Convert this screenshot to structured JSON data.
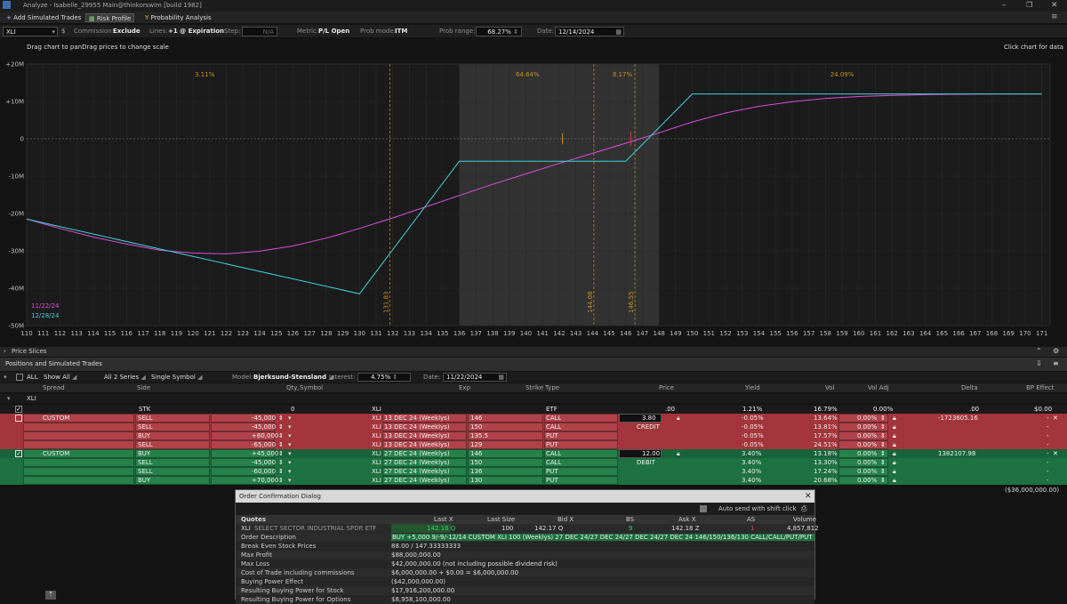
{
  "window": {
    "title": "Analyze - Isabelle_29955 Main@thinkorswim [build 1982]"
  },
  "toolbar": {
    "add_trades": "Add Simulated Trades",
    "risk_profile": "Risk Profile",
    "probability": "Probability Analysis"
  },
  "settings": {
    "symbol": "XLI",
    "commission_label": "Commission:",
    "commission_value": "Exclude",
    "lines_label": "Lines:",
    "lines_value": "+1 @ Expiration",
    "step_label": "Step:",
    "step_value": "N/A",
    "metric_label": "Metric:",
    "metric_value": "P/L Open",
    "prob_mode_label": "Prob mode:",
    "prob_mode_value": "ITM",
    "prob_range_label": "Prob range:",
    "prob_range_value": "68.27%",
    "date_label": "Date:",
    "date_value": "12/14/2024"
  },
  "chart_hint": {
    "left": "Drag chart to panDrag prices to change scale",
    "right": "Click chart for data"
  },
  "chart_data": {
    "type": "line",
    "x_range": [
      110,
      171.5
    ],
    "y_range": [
      -50,
      20
    ],
    "x_ticks": [
      110,
      111,
      112,
      113,
      114,
      115,
      116,
      117,
      118,
      119,
      120,
      121,
      122,
      123,
      124,
      125,
      126,
      127,
      128,
      129,
      130,
      131,
      132,
      133,
      134,
      135,
      136,
      137,
      138,
      139,
      140,
      141,
      142,
      143,
      144,
      145,
      146,
      147,
      148,
      149,
      150,
      151,
      152,
      153,
      154,
      155,
      156,
      157,
      158,
      159,
      160,
      161,
      162,
      163,
      164,
      165,
      166,
      167,
      168,
      169,
      170,
      171
    ],
    "y_ticks": [
      {
        "v": 20,
        "label": "+20M"
      },
      {
        "v": 10,
        "label": "+10M"
      },
      {
        "v": 0,
        "label": "0"
      },
      {
        "v": -10,
        "label": "-10M"
      },
      {
        "v": -20,
        "label": "-20M"
      },
      {
        "v": -30,
        "label": "-30M"
      },
      {
        "v": -40,
        "label": "-40M"
      },
      {
        "v": -50,
        "label": "-50M"
      }
    ],
    "shaded_range": [
      136,
      148
    ],
    "prob_labels": [
      {
        "x": 120.7,
        "label": "3.11%"
      },
      {
        "x": 140.1,
        "label": "64.64%"
      },
      {
        "x": 145.8,
        "label": "8.17%"
      },
      {
        "x": 159.0,
        "label": "24.09%"
      }
    ],
    "vlines": [
      {
        "x": 131.83,
        "label": "131.83"
      },
      {
        "x": 144.08,
        "label": "144.08"
      },
      {
        "x": 146.55,
        "label": "146.55"
      }
    ],
    "series": [
      {
        "name": "11/22/24",
        "color": "#d94fd9",
        "x": [
          110,
          112,
          114,
          116,
          118,
          120,
          122,
          124,
          126,
          128,
          130,
          132,
          134,
          136,
          138,
          140,
          142,
          144,
          146,
          148,
          150,
          152,
          154,
          156,
          158,
          160,
          162,
          164,
          166,
          168,
          171
        ],
        "y": [
          -21.5,
          -24,
          -26.3,
          -28.2,
          -29.8,
          -30.6,
          -30.8,
          -30.1,
          -28.7,
          -26.6,
          -24,
          -21.2,
          -18.2,
          -15.2,
          -12.2,
          -9.4,
          -6.6,
          -3.9,
          -1.2,
          1.6,
          4.5,
          6.9,
          8.7,
          9.9,
          10.8,
          11.3,
          11.6,
          11.8,
          11.9,
          12,
          12
        ]
      },
      {
        "name": "12/28/24",
        "color": "#3fd1d9",
        "x": [
          110,
          130,
          136,
          146,
          150,
          171
        ],
        "y": [
          -21.5,
          -41.5,
          -6,
          -6,
          12,
          12
        ]
      }
    ]
  },
  "panels": {
    "price_slices": "Price Slices",
    "positions": "Positions and Simulated Trades"
  },
  "filters": {
    "all": "ALL",
    "show_all": "Show All",
    "series": "All 2 Series",
    "symbol_mode": "Single Symbol",
    "model_label": "Model:",
    "model_value": "Bjerksund-Stensland",
    "interest_label": "Interest:",
    "interest_value": "4.75%",
    "date_label": "Date:",
    "date_value": "11/22/2024"
  },
  "columns": [
    "Spread",
    "Side",
    "Qty",
    "Symbol",
    "Exp",
    "Strike",
    "Type",
    "Price",
    "Yield",
    "Vol",
    "Vol Adj",
    "Delta",
    "BP Effect"
  ],
  "group": {
    "label": "XLI"
  },
  "stk": {
    "side": "STK",
    "qty": "0",
    "symbol": "XLI",
    "type": "ETF",
    "price": ".00",
    "yield": "1.21%",
    "vol": "16.79%",
    "voladj": "0.00%",
    "delta": ".00",
    "bp": "$0.00"
  },
  "legs": [
    {
      "spread": "CUSTOM",
      "side": "SELL",
      "qty": "-45,000",
      "symbol": "XLI",
      "exp": "13 DEC 24 (Weeklys)",
      "strike": "146",
      "type": "CALL",
      "price": "3.80",
      "yield": "-0.05%",
      "vol": "13.64%",
      "voladj": "0.00%",
      "delta": "-1723605.16",
      "bp": "-",
      "color": "red"
    },
    {
      "spread": "",
      "side": "SELL",
      "qty": "-45,000",
      "symbol": "XLI",
      "exp": "13 DEC 24 (Weeklys)",
      "strike": "150",
      "type": "CALL",
      "price": "CREDIT",
      "yield": "-0.05%",
      "vol": "13.81%",
      "voladj": "0.00%",
      "delta": "",
      "bp": "-",
      "color": "red"
    },
    {
      "spread": "",
      "side": "BUY",
      "qty": "+60,000",
      "symbol": "XLI",
      "exp": "13 DEC 24 (Weeklys)",
      "strike": "135.5",
      "type": "PUT",
      "price": "",
      "yield": "-0.05%",
      "vol": "17.57%",
      "voladj": "0.00%",
      "delta": "",
      "bp": "-",
      "color": "red"
    },
    {
      "spread": "",
      "side": "SELL",
      "qty": "-65,000",
      "symbol": "XLI",
      "exp": "13 DEC 24 (Weeklys)",
      "strike": "129",
      "type": "PUT",
      "price": "",
      "yield": "-0.05%",
      "vol": "24.51%",
      "voladj": "0.00%",
      "delta": "",
      "bp": "-",
      "color": "red"
    },
    {
      "spread": "CUSTOM",
      "side": "BUY",
      "qty": "+45,000",
      "symbol": "XLI",
      "exp": "27 DEC 24 (Weeklys)",
      "strike": "146",
      "type": "CALL",
      "price": "12.00",
      "yield": "3.40%",
      "vol": "13.18%",
      "voladj": "0.00%",
      "delta": "1382107.98",
      "bp": "-",
      "color": "green"
    },
    {
      "spread": "",
      "side": "SELL",
      "qty": "-45,000",
      "symbol": "XLI",
      "exp": "27 DEC 24 (Weeklys)",
      "strike": "150",
      "type": "CALL",
      "price": "DEBIT",
      "yield": "3.40%",
      "vol": "13.30%",
      "voladj": "0.00%",
      "delta": "",
      "bp": "-",
      "color": "green"
    },
    {
      "spread": "",
      "side": "SELL",
      "qty": "-60,000",
      "symbol": "XLI",
      "exp": "27 DEC 24 (Weeklys)",
      "strike": "136",
      "type": "PUT",
      "price": "",
      "yield": "3.40%",
      "vol": "17.24%",
      "voladj": "0.00%",
      "delta": "",
      "bp": "-",
      "color": "green"
    },
    {
      "spread": "",
      "side": "BUY",
      "qty": "+70,000",
      "symbol": "XLI",
      "exp": "27 DEC 24 (Weeklys)",
      "strike": "130",
      "type": "PUT",
      "price": "",
      "yield": "3.40%",
      "vol": "20.68%",
      "voladj": "0.00%",
      "delta": "",
      "bp": "-",
      "color": "green"
    }
  ],
  "total_bp": "($36,000,000.00)",
  "dialog": {
    "title": "Order Confirmation Dialog",
    "auto_send": "Auto send with shift click",
    "quote_headers": [
      "Quotes",
      "Last X",
      "Last Size",
      "Bid X",
      "BS",
      "Ask X",
      "AS",
      "Volume"
    ],
    "quote_row": {
      "symbol": "XLI",
      "desc": "SELECT SECTOR INDUSTRIAL SPDR ETF",
      "last": "142.18 Q",
      "size": "100",
      "bid": "142.17 Q",
      "bs": "9",
      "ask": "142.18 Z",
      "as": "1",
      "volume": "4,857,812"
    },
    "rows": [
      {
        "k": "Order Description",
        "v": "BUY +5,000 9/-9/-12/14 CUSTOM XLI 100 (Weeklys) 27 DEC 24/27 DEC 24/27 DEC 24/27 DEC 24 146/150/136/130 CALL/CALL/PUT/PUT @12.00 LMT [T..."
      },
      {
        "k": "Break Even Stock Prices",
        "v": "88.00 / 147.33333333"
      },
      {
        "k": "Max Profit",
        "v": "$88,000,000.00"
      },
      {
        "k": "Max Loss",
        "v": "$42,000,000.00 (not including possible dividend risk)"
      },
      {
        "k": "Cost of Trade including commissions",
        "v": "$6,000,000.00 + $0.00 = $6,000,000.00"
      },
      {
        "k": "Buying Power Effect",
        "v": "($42,000,000.00)"
      },
      {
        "k": "Resulting Buying Power for Stock",
        "v": "$17,916,200,000.00"
      },
      {
        "k": "Resulting Buying Power for Options",
        "v": "$8,958,100,000.00"
      }
    ]
  }
}
